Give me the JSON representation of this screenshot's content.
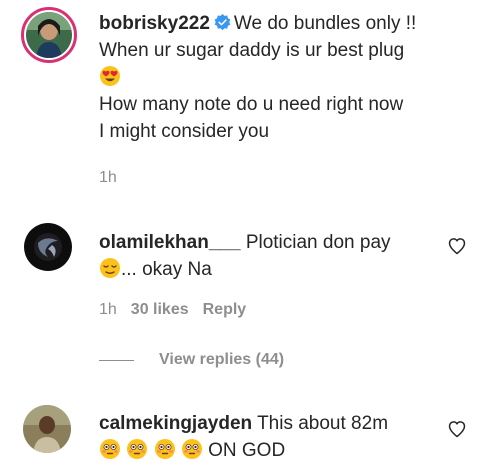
{
  "comments": [
    {
      "username": "bobrisky222",
      "verified": true,
      "text_line1": "We do bundles only !!",
      "text_line2": "When ur sugar daddy is ur best plug",
      "text_line3": "How many note do u need right now",
      "text_line4": "I might consider you",
      "time": "1h"
    },
    {
      "username": "olamilekhan___",
      "text_line1": "Plotician don pay",
      "text_line2": "... okay Na",
      "time": "1h",
      "likes": "30 likes",
      "reply_label": "Reply",
      "view_replies": "View replies (44)"
    },
    {
      "username": "calmekingjayden",
      "text_line1": "This about 82m",
      "text_line2": "ON GOD"
    }
  ],
  "colors": {
    "verified": "#3897f0",
    "muted": "#8e8e8e",
    "text": "#262626",
    "story_ring": "#d93175"
  },
  "icons": [
    "verified-badge-icon",
    "heart-eyes-emoji",
    "relieved-face-emoji",
    "flushed-face-emoji",
    "heart-icon"
  ]
}
